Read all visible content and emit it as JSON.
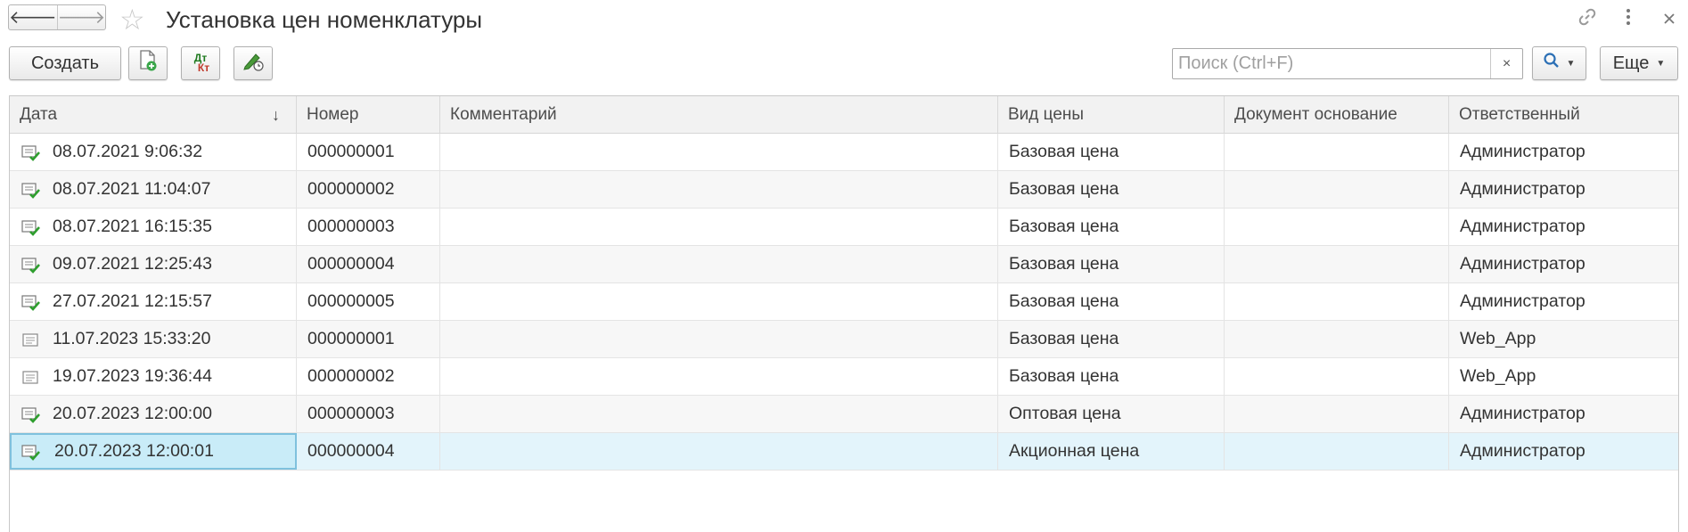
{
  "window": {
    "title": "Установка цен номенклатуры"
  },
  "toolbar": {
    "create_label": "Создать",
    "dt_label": "Дт",
    "kt_label": "Кт",
    "search_placeholder": "Поиск (Ctrl+F)",
    "search_clear": "×",
    "more_label": "Еще"
  },
  "table": {
    "columns": {
      "date": "Дата",
      "number": "Номер",
      "comment": "Комментарий",
      "price_kind": "Вид цены",
      "base_doc": "Документ основание",
      "responsible": "Ответственный"
    },
    "sort_indicator": "↓",
    "rows": [
      {
        "date": "08.07.2021 9:06:32",
        "number": "000000001",
        "comment": "",
        "price_kind": "Базовая цена",
        "base_doc": "",
        "responsible": "Администратор",
        "posted": true
      },
      {
        "date": "08.07.2021 11:04:07",
        "number": "000000002",
        "comment": "",
        "price_kind": "Базовая цена",
        "base_doc": "",
        "responsible": "Администратор",
        "posted": true
      },
      {
        "date": "08.07.2021 16:15:35",
        "number": "000000003",
        "comment": "",
        "price_kind": "Базовая цена",
        "base_doc": "",
        "responsible": "Администратор",
        "posted": true
      },
      {
        "date": "09.07.2021 12:25:43",
        "number": "000000004",
        "comment": "",
        "price_kind": "Базовая цена",
        "base_doc": "",
        "responsible": "Администратор",
        "posted": true
      },
      {
        "date": "27.07.2021 12:15:57",
        "number": "000000005",
        "comment": "",
        "price_kind": "Базовая цена",
        "base_doc": "",
        "responsible": "Администратор",
        "posted": true
      },
      {
        "date": "11.07.2023 15:33:20",
        "number": "000000001",
        "comment": "",
        "price_kind": "Базовая цена",
        "base_doc": "",
        "responsible": "Web_App",
        "posted": false
      },
      {
        "date": "19.07.2023 19:36:44",
        "number": "000000002",
        "comment": "",
        "price_kind": "Базовая цена",
        "base_doc": "",
        "responsible": "Web_App",
        "posted": false
      },
      {
        "date": "20.07.2023 12:00:00",
        "number": "000000003",
        "comment": "",
        "price_kind": "Оптовая цена",
        "base_doc": "",
        "responsible": "Администратор",
        "posted": true
      },
      {
        "date": "20.07.2023 12:00:01",
        "number": "000000004",
        "comment": "",
        "price_kind": "Акционная цена",
        "base_doc": "",
        "responsible": "Администратор",
        "posted": true,
        "selected": true
      }
    ]
  },
  "icons": {
    "back": "arrow-left-icon",
    "forward": "arrow-right-icon",
    "favorite": "star-icon",
    "link": "link-icon",
    "menu": "kebab-menu-icon",
    "close": "close-icon",
    "new_document": "new-document-icon",
    "dt_kt": "dt-kt-icon",
    "sign": "edit-schedule-icon",
    "search": "search-icon",
    "posted": "posted-document-icon",
    "draft": "document-icon"
  },
  "colors": {
    "selection_bg": "#e3f4fb",
    "selected_cell": "#c9ecf8",
    "posted_check": "#2e9e2e"
  }
}
